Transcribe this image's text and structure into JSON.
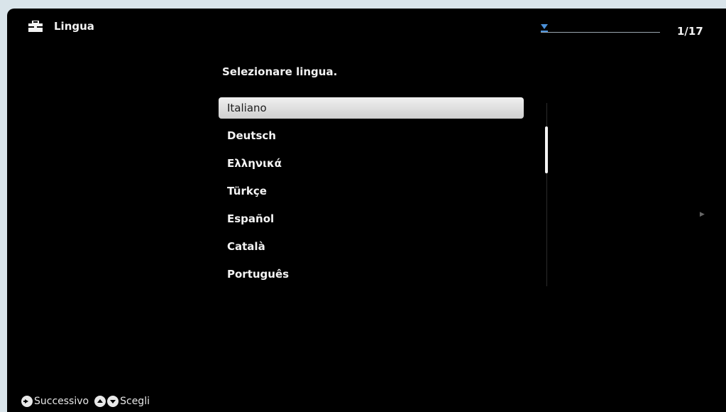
{
  "header": {
    "title": "Lingua",
    "page_counter": "1/17",
    "page_progress": 0.06
  },
  "prompt": "Selezionare lingua.",
  "languages": [
    "Italiano",
    "Deutsch",
    "Ελληνικά",
    "Türkçe",
    "Español",
    "Català",
    "Português"
  ],
  "selected_index": 0,
  "icons": {
    "title_icon": "toolbox-icon",
    "next_icon": "dpad-right-icon",
    "select_icons": [
      "dpad-up-icon",
      "dpad-down-icon"
    ],
    "more_indicator": "right-arrow-icon"
  },
  "footer": {
    "next_label": "Successivo",
    "select_label": "Scegli"
  },
  "colors": {
    "background": "#000000",
    "text": "#f2f2f2",
    "selection": "#e6e6e6",
    "progress_marker": "#4a90d9"
  }
}
